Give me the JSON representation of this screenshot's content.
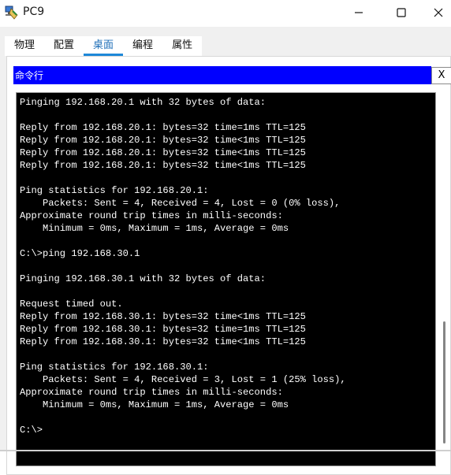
{
  "window": {
    "title": "PC9",
    "icon": "packet-tracer-pc-icon",
    "controls": [
      "minimize-icon",
      "maximize-icon",
      "close-icon"
    ]
  },
  "tabs": [
    "物理",
    "配置",
    "桌面",
    "编程",
    "属性"
  ],
  "active_tab": "桌面",
  "command_prompt": {
    "title": "命令行",
    "close_label": "X",
    "lines": [
      "Pinging 192.168.20.1 with 32 bytes of data:",
      "",
      "Reply from 192.168.20.1: bytes=32 time=1ms TTL=125",
      "Reply from 192.168.20.1: bytes=32 time<1ms TTL=125",
      "Reply from 192.168.20.1: bytes=32 time<1ms TTL=125",
      "Reply from 192.168.20.1: bytes=32 time<1ms TTL=125",
      "",
      "Ping statistics for 192.168.20.1:",
      "    Packets: Sent = 4, Received = 4, Lost = 0 (0% loss),",
      "Approximate round trip times in milli-seconds:",
      "    Minimum = 0ms, Maximum = 1ms, Average = 0ms",
      "",
      "C:\\>ping 192.168.30.1",
      "",
      "Pinging 192.168.30.1 with 32 bytes of data:",
      "",
      "Request timed out.",
      "Reply from 192.168.30.1: bytes=32 time<1ms TTL=125",
      "Reply from 192.168.30.1: bytes=32 time=1ms TTL=125",
      "Reply from 192.168.30.1: bytes=32 time<1ms TTL=125",
      "",
      "Ping statistics for 192.168.30.1:",
      "    Packets: Sent = 4, Received = 3, Lost = 1 (25% loss),",
      "Approximate round trip times in milli-seconds:",
      "    Minimum = 0ms, Maximum = 1ms, Average = 0ms",
      "",
      "C:\\>"
    ]
  },
  "colors": {
    "header_blue": "#0000ff",
    "terminal_bg": "#000000",
    "terminal_text": "#ffffff",
    "active_tab_underline": "#1e88d8"
  }
}
